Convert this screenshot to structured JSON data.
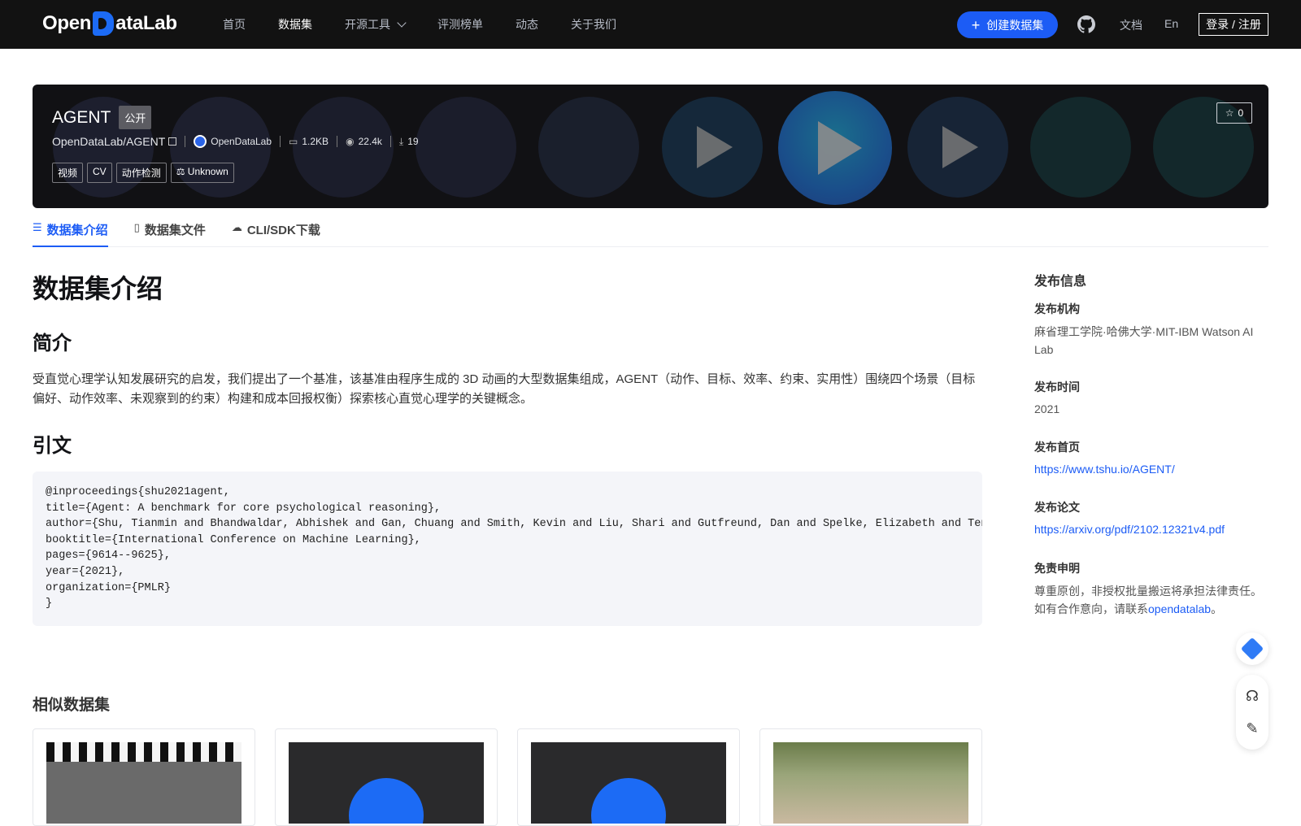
{
  "header": {
    "logo": "OpenDataLab",
    "nav": [
      "首页",
      "数据集",
      "开源工具",
      "评测榜单",
      "动态",
      "关于我们"
    ],
    "create_label": "创建数据集",
    "docs_label": "文档",
    "lang_label": "En",
    "login_label": "登录 / 注册"
  },
  "dataset": {
    "name": "AGENT",
    "visibility": "公开",
    "full_name": "OpenDataLab/AGENT",
    "org": "OpenDataLab",
    "size": "1.2KB",
    "views": "22.4k",
    "downloads": "19",
    "tags": [
      "视频",
      "CV",
      "动作检测"
    ],
    "license": "Unknown",
    "stars": "0"
  },
  "tabs": [
    "数据集介绍",
    "数据集文件",
    "CLI/SDK下载"
  ],
  "content": {
    "heading": "数据集介绍",
    "intro_heading": "简介",
    "intro_text": "受直觉心理学认知发展研究的启发，我们提出了一个基准，该基准由程序生成的 3D 动画的大型数据集组成，AGENT（动作、目标、效率、约束、实用性）围绕四个场景（目标偏好、动作效率、未观察到的约束）构建和成本回报权衡）探索核心直觉心理学的关键概念。",
    "citation_heading": "引文",
    "citation": "@inproceedings{shu2021agent,\ntitle={Agent: A benchmark for core psychological reasoning},\nauthor={Shu, Tianmin and Bhandwaldar, Abhishek and Gan, Chuang and Smith, Kevin and Liu, Shari and Gutfreund, Dan and Spelke, Elizabeth and Tenenbaum, Josh and Ullman, Tomer},\nbooktitle={International Conference on Machine Learning},\npages={9614--9625},\nyear={2021},\norganization={PMLR}\n}"
  },
  "similar": {
    "title": "相似数据集"
  },
  "sidebar": {
    "title": "发布信息",
    "org_label": "发布机构",
    "org_value": "麻省理工学院·哈佛大学·MIT-IBM Watson AI Lab",
    "time_label": "发布时间",
    "time_value": "2021",
    "home_label": "发布首页",
    "home_value": "https://www.tshu.io/AGENT/",
    "paper_label": "发布论文",
    "paper_value": "https://arxiv.org/pdf/2102.12321v4.pdf",
    "disclaimer_label": "免责申明",
    "disclaimer_text1": "尊重原创，非授权批量搬运将承担法律责任。",
    "disclaimer_text2": "如有合作意向，请联系",
    "disclaimer_link": "opendatalab",
    "disclaimer_end": "。"
  }
}
